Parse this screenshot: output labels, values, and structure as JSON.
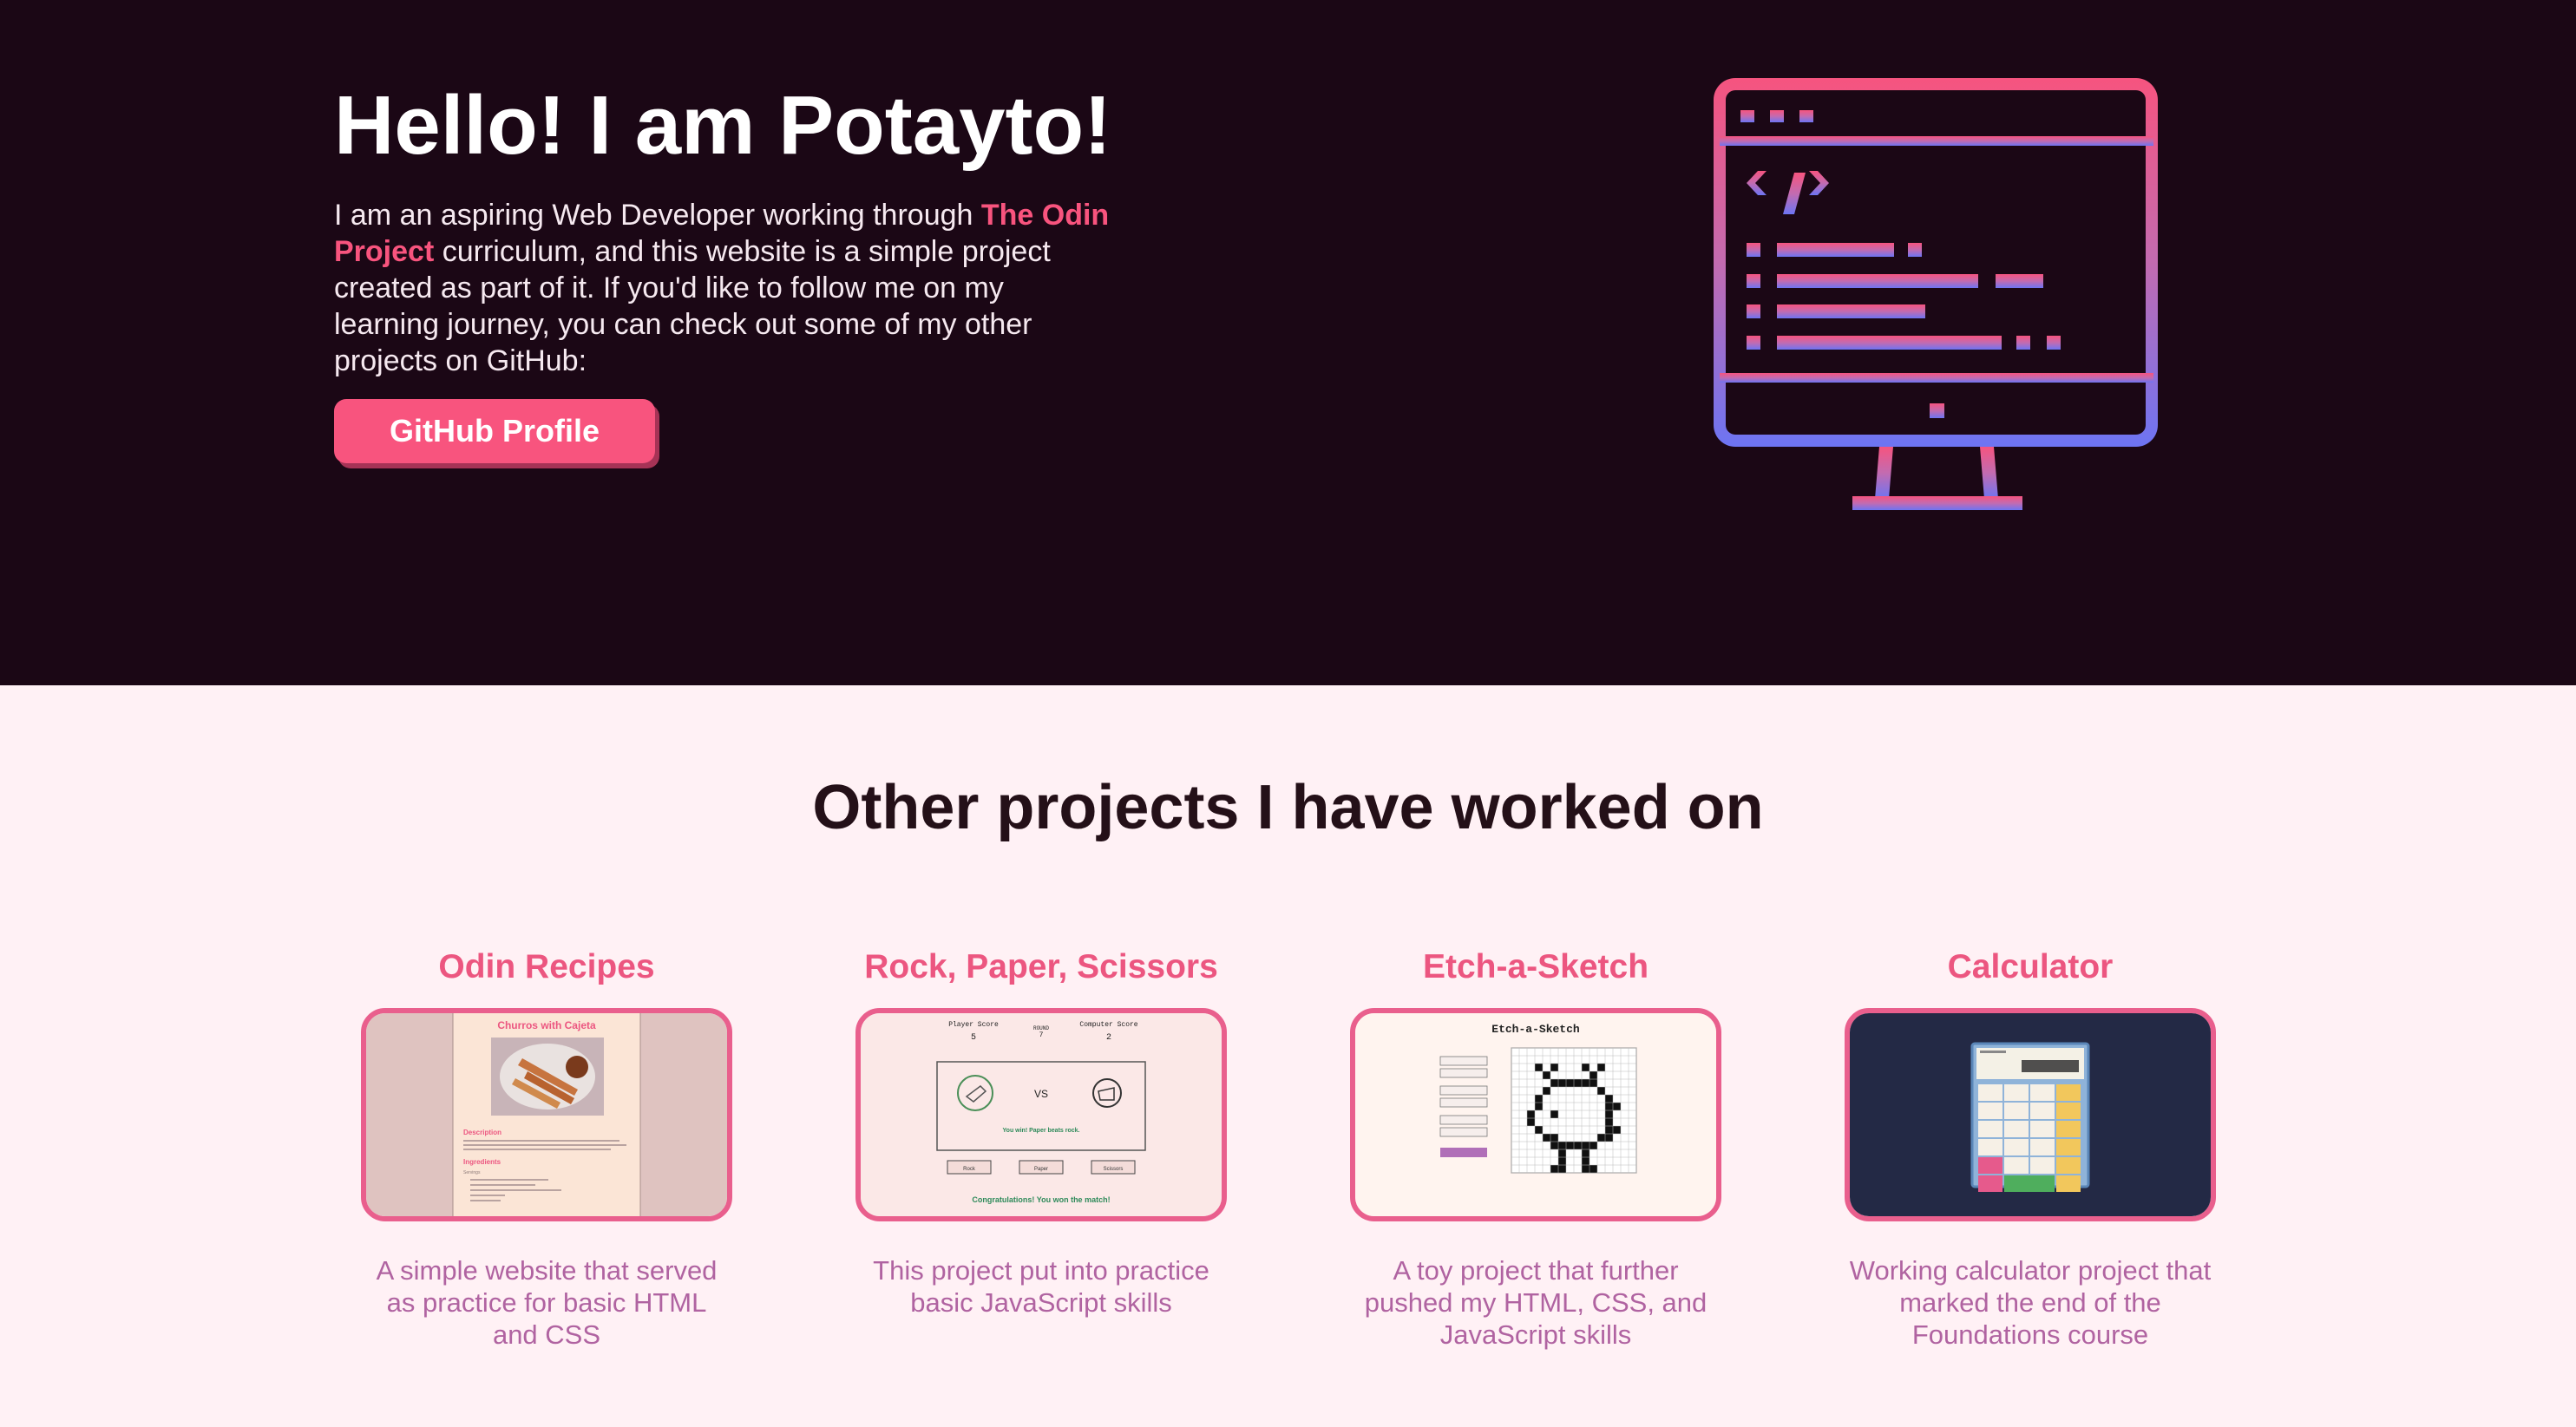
{
  "hero": {
    "title": "Hello! I am Potayto!",
    "intro_before": "I am an aspiring Web Developer working through ",
    "odin_link": "The Odin Project",
    "intro_after": " curriculum, and this website is a simple project created as part of it. If you'd like to follow me on my learning journey, you can check out some of my other projects on GitHub:",
    "button_label": "GitHub Profile",
    "illustration_icon": "monitor-code-icon"
  },
  "projects": {
    "heading": "Other projects I have worked on",
    "items": [
      {
        "title": "Odin Recipes",
        "description": "A simple website that served as practice for basic HTML and CSS",
        "preview": {
          "heading": "Churros with Cajeta",
          "sections": [
            "Description",
            "Ingredients"
          ],
          "text_fragments": [
            "Servings"
          ]
        }
      },
      {
        "title": "Rock, Paper, Scissors",
        "description": "This project put into practice basic JavaScript skills",
        "preview": {
          "player_label": "Player Score",
          "player_score": "5",
          "round_label": "ROUND",
          "round": "7",
          "computer_label": "Computer Score",
          "computer_score": "2",
          "vs": "VS",
          "result": "You win! Paper beats rock.",
          "buttons": [
            "Rock",
            "Paper",
            "Scissors"
          ],
          "final": "Congratulations! You won the match!"
        }
      },
      {
        "title": "Etch-a-Sketch",
        "description": "A toy project that further pushed my HTML, CSS, and JavaScript skills"
      },
      {
        "title": "Calculator",
        "description": "Working calculator project that marked the end of the Foundations course"
      }
    ]
  },
  "colors": {
    "hero_bg": "#1b0715",
    "page_bg": "#fff1f5",
    "accent": "#f8547e",
    "card_title": "#ec5680",
    "card_desc": "#b063a1",
    "thumb_border": "#e95f8d",
    "monitor_gradient_top": "#f6547f",
    "monitor_gradient_bottom": "#6d74f3"
  }
}
